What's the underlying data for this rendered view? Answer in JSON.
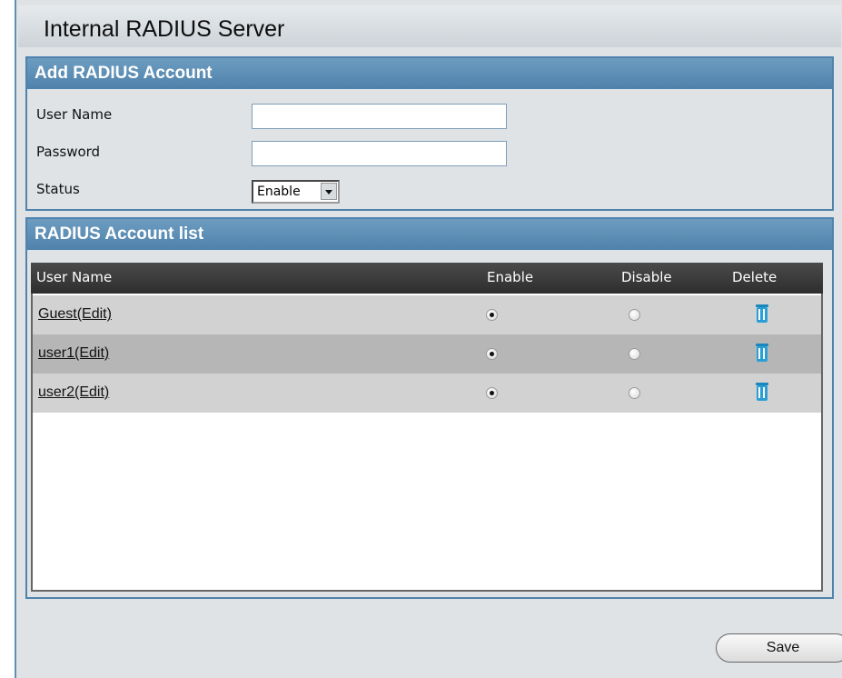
{
  "header": {
    "title": "Internal RADIUS Server"
  },
  "add_section": {
    "title": "Add RADIUS Account",
    "fields": {
      "user_name_label": "User Name",
      "user_name_value": "",
      "password_label": "Password",
      "password_value": "",
      "status_label": "Status",
      "status_value": "Enable"
    }
  },
  "list_section": {
    "title": "RADIUS Account list",
    "columns": {
      "user_name": "User Name",
      "enable": "Enable",
      "disable": "Disable",
      "delete": "Delete"
    },
    "rows": [
      {
        "name": "Guest(Edit)",
        "enabled": true,
        "delete_icon": "trash-icon"
      },
      {
        "name": "user1(Edit)",
        "enabled": true,
        "delete_icon": "trash-icon"
      },
      {
        "name": "user2(Edit)",
        "enabled": true,
        "delete_icon": "trash-icon"
      }
    ]
  },
  "footer": {
    "save_label": "Save"
  },
  "colors": {
    "section_header": "#4f82ab",
    "row_odd": "#d2d2d2",
    "row_even": "#b6b6b6",
    "trash_icon": "#2a9fd6"
  }
}
